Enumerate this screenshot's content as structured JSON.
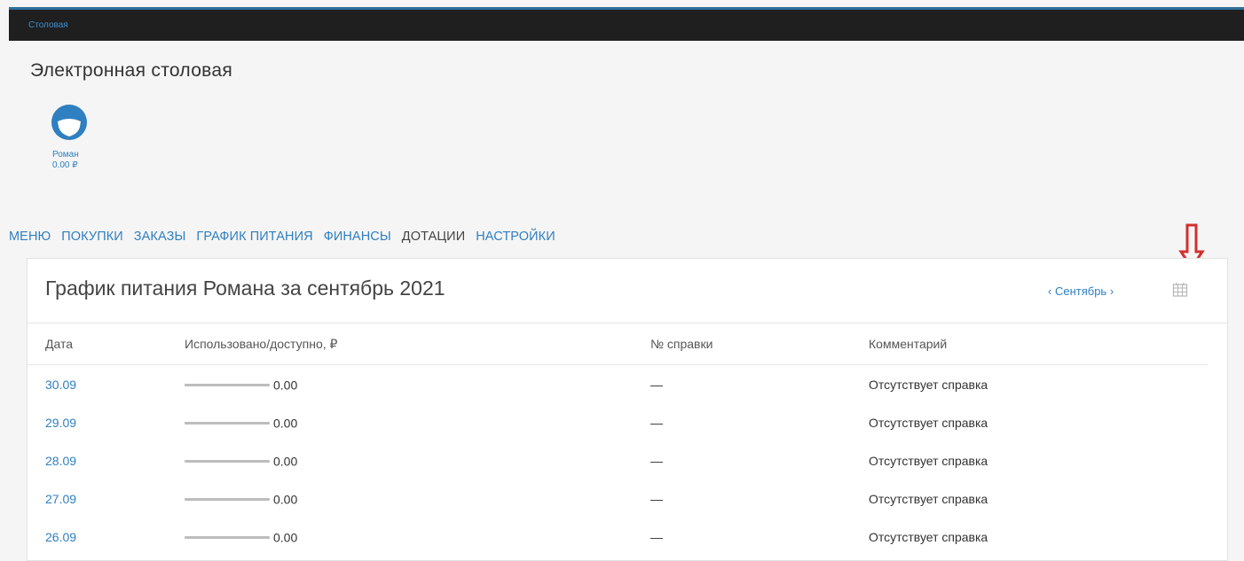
{
  "topbar": {
    "crumb": "Столовая"
  },
  "page": {
    "title": "Электронная столовая"
  },
  "user": {
    "name": "Роман",
    "balance": "0.00 ₽"
  },
  "nav": {
    "items": [
      {
        "label": "МЕНЮ",
        "active": false
      },
      {
        "label": "ПОКУПКИ",
        "active": false
      },
      {
        "label": "ЗАКАЗЫ",
        "active": false
      },
      {
        "label": "ГРАФИК ПИТАНИЯ",
        "active": false
      },
      {
        "label": "ФИНАНСЫ",
        "active": false
      },
      {
        "label": "ДОТАЦИИ",
        "active": true
      },
      {
        "label": "НАСТРОЙКИ",
        "active": false
      }
    ]
  },
  "panel": {
    "title": "График питания Романа за сентябрь 2021",
    "month_prev": "‹",
    "month_label": "Сентябрь",
    "month_next": "›",
    "calendar_icon": "calendar-icon"
  },
  "table": {
    "headers": {
      "date": "Дата",
      "used": "Использовано/доступно, ₽",
      "ref": "№ справки",
      "comment": "Комментарий"
    },
    "rows": [
      {
        "date": "30.09",
        "used": "0.00",
        "ref": "—",
        "comment": "Отсутствует справка"
      },
      {
        "date": "29.09",
        "used": "0.00",
        "ref": "—",
        "comment": "Отсутствует справка"
      },
      {
        "date": "28.09",
        "used": "0.00",
        "ref": "—",
        "comment": "Отсутствует справка"
      },
      {
        "date": "27.09",
        "used": "0.00",
        "ref": "—",
        "comment": "Отсутствует справка"
      },
      {
        "date": "26.09",
        "used": "0.00",
        "ref": "—",
        "comment": "Отсутствует справка"
      }
    ]
  },
  "colors": {
    "link": "#2f7fc1",
    "topbar": "#1f1f1f",
    "annotation_arrow": "#d32f2f"
  }
}
